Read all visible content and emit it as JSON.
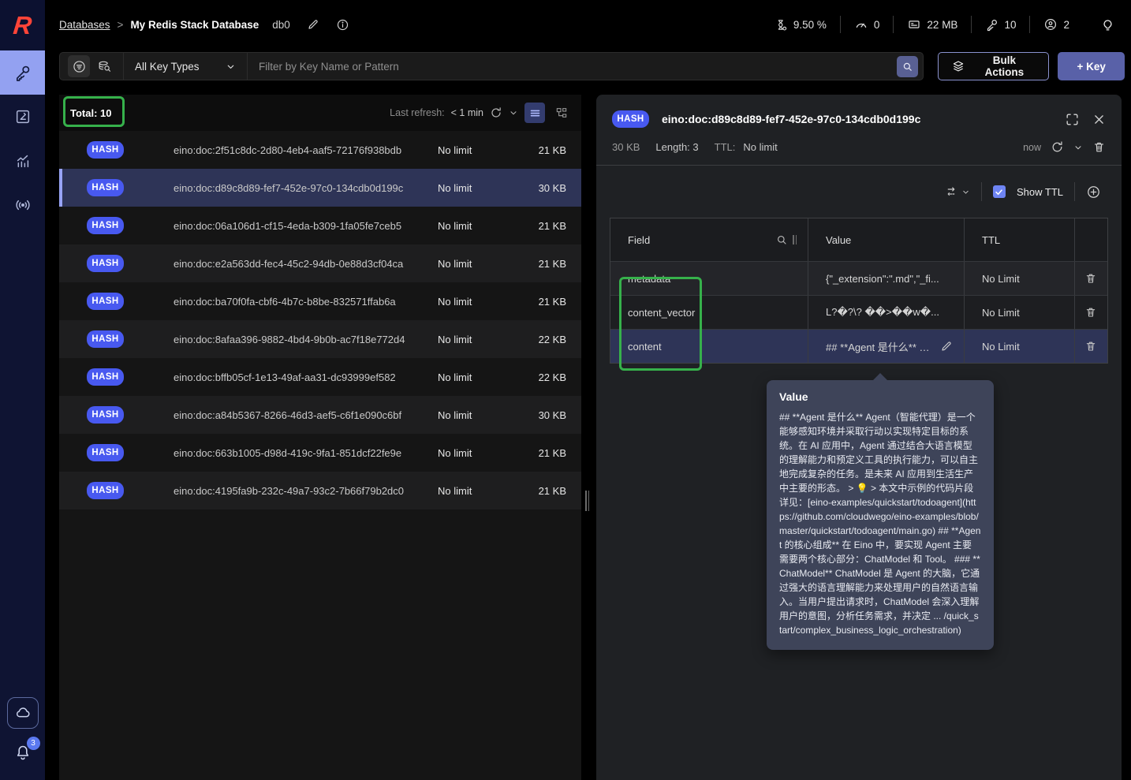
{
  "colors": {
    "accent_badge": "#4859f0",
    "nav_active": "#93a1f1",
    "annotation_green": "#36b14b",
    "selected_row": "#2e3457",
    "primary_button": "#5961a8",
    "tooltip_bg": "#3e4459",
    "logo_red": "#ff4438"
  },
  "sidebar": {
    "notification_count": "3"
  },
  "header": {
    "breadcrumb_root": "Databases",
    "breadcrumb_sep": ">",
    "db_name": "My Redis Stack Database",
    "db_index": "db0",
    "stats": [
      {
        "name": "cpu-usage",
        "value": "9.50 %"
      },
      {
        "name": "commands-per-sec",
        "value": "0"
      },
      {
        "name": "memory",
        "value": "22 MB"
      },
      {
        "name": "total-keys",
        "value": "10"
      },
      {
        "name": "connected-clients",
        "value": "2"
      }
    ]
  },
  "filter_bar": {
    "key_type": "All Key Types",
    "placeholder": "Filter by Key Name or Pattern",
    "bulk_actions": "Bulk Actions",
    "add_key": "+ Key"
  },
  "key_list": {
    "total": "Total: 10",
    "last_refresh_label": "Last refresh:",
    "last_refresh_value": "< 1 min",
    "rows": [
      {
        "type": "HASH",
        "key": "eino:doc:2f51c8dc-2d80-4eb4-aaf5-72176f938bdb",
        "ttl": "No limit",
        "size": "21 KB"
      },
      {
        "type": "HASH",
        "key": "eino:doc:d89c8d89-fef7-452e-97c0-134cdb0d199c",
        "ttl": "No limit",
        "size": "30 KB"
      },
      {
        "type": "HASH",
        "key": "eino:doc:06a106d1-cf15-4eda-b309-1fa05fe7ceb5",
        "ttl": "No limit",
        "size": "21 KB"
      },
      {
        "type": "HASH",
        "key": "eino:doc:e2a563dd-fec4-45c2-94db-0e88d3cf04ca",
        "ttl": "No limit",
        "size": "21 KB"
      },
      {
        "type": "HASH",
        "key": "eino:doc:ba70f0fa-cbf6-4b7c-b8be-832571ffab6a",
        "ttl": "No limit",
        "size": "21 KB"
      },
      {
        "type": "HASH",
        "key": "eino:doc:8afaa396-9882-4bd4-9b0b-ac7f18e772d4",
        "ttl": "No limit",
        "size": "22 KB"
      },
      {
        "type": "HASH",
        "key": "eino:doc:bffb05cf-1e13-49af-aa31-dc93999ef582",
        "ttl": "No limit",
        "size": "22 KB"
      },
      {
        "type": "HASH",
        "key": "eino:doc:a84b5367-8266-46d3-aef5-c6f1e090c6bf",
        "ttl": "No limit",
        "size": "30 KB"
      },
      {
        "type": "HASH",
        "key": "eino:doc:663b1005-d98d-419c-9fa1-851dcf22fe9e",
        "ttl": "No limit",
        "size": "21 KB"
      },
      {
        "type": "HASH",
        "key": "eino:doc:4195fa9b-232c-49a7-93c2-7b66f79b2dc0",
        "ttl": "No limit",
        "size": "21 KB"
      }
    ]
  },
  "details": {
    "type": "HASH",
    "key": "eino:doc:d89c8d89-fef7-452e-97c0-134cdb0d199c",
    "size": "30 KB",
    "length": "Length: 3",
    "ttl_label": "TTL:",
    "ttl_value": "No limit",
    "refreshed": "now",
    "show_ttl": "Show TTL",
    "columns": {
      "field": "Field",
      "value": "Value",
      "ttl": "TTL"
    },
    "rows": [
      {
        "field": "metadata",
        "value": "{\"_extension\":\".md\",\"_fi...",
        "ttl": "No Limit"
      },
      {
        "field": "content_vector",
        "value": "L?�?\\? ��>��w�...",
        "ttl": "No Limit"
      },
      {
        "field": "content",
        "value": "## **Agent 是什么** A...",
        "ttl": "No Limit"
      }
    ],
    "tooltip": {
      "title": "Value",
      "text": "## **Agent 是什么** Agent（智能代理）是一个能够感知环境并采取行动以实现特定目标的系统。在 AI 应用中，Agent 通过结合大语言模型的理解能力和预定义工具的执行能力，可以自主地完成复杂的任务。是未来 AI 应用到生活生产中主要的形态。 > 💡 > 本文中示例的代码片段详见：[eino-examples/quickstart/todoagent](https://github.com/cloudwego/eino-examples/blob/master/quickstart/todoagent/main.go) ## **Agent 的核心组成** 在 Eino 中，要实现 Agent 主要需要两个核心部分：ChatModel 和 Tool。 ### **ChatModel** ChatModel 是 Agent 的大脑，它通过强大的语言理解能力来处理用户的自然语言输入。当用户提出请求时，ChatModel 会深入理解用户的意图，分析任务需求，并决定 ... /quick_start/complex_business_logic_orchestration)"
    }
  }
}
